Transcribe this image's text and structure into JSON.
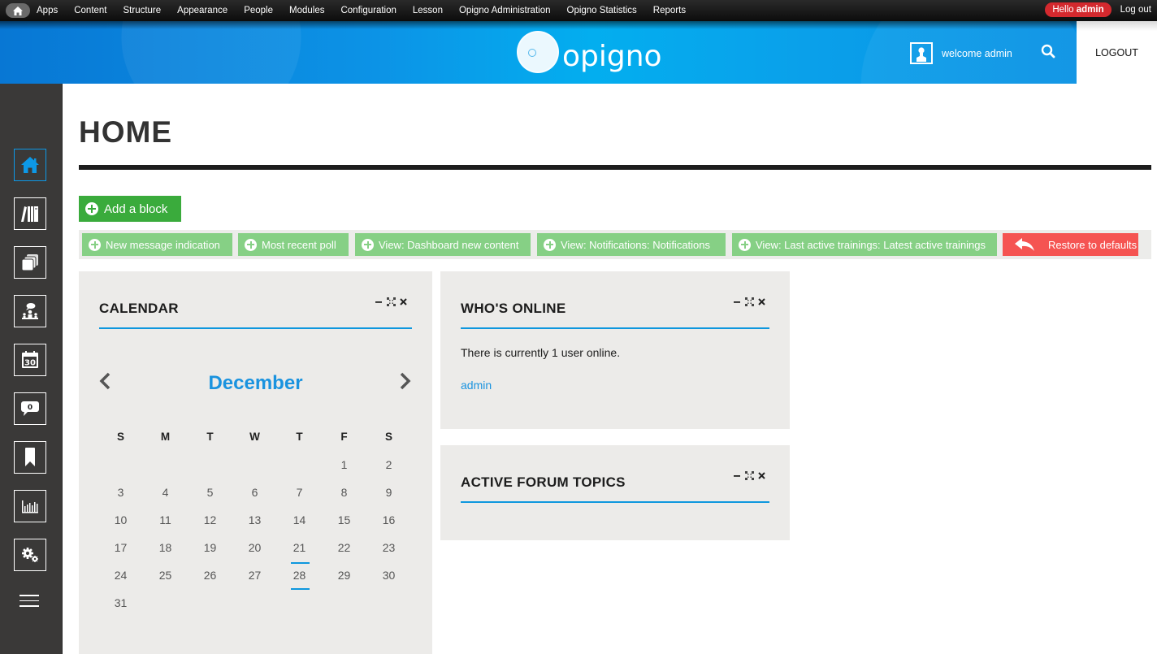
{
  "toolbar": {
    "items": [
      "Apps",
      "Content",
      "Structure",
      "Appearance",
      "People",
      "Modules",
      "Configuration",
      "Lesson",
      "Opigno Administration",
      "Opigno Statistics",
      "Reports"
    ],
    "hello_prefix": "Hello ",
    "hello_user": "admin",
    "logout": "Log out"
  },
  "header": {
    "logo_text": "opigno",
    "welcome": "welcome admin",
    "logout": "LOGOUT"
  },
  "sidebar": {
    "items": [
      {
        "name": "home",
        "active": true
      },
      {
        "name": "trainings",
        "active": false
      },
      {
        "name": "courses",
        "active": false
      },
      {
        "name": "forum",
        "active": false
      },
      {
        "name": "calendar",
        "active": false,
        "badge": "30"
      },
      {
        "name": "messages",
        "active": false,
        "badge": "0"
      },
      {
        "name": "bookmarks",
        "active": false
      },
      {
        "name": "statistics",
        "active": false
      },
      {
        "name": "settings",
        "active": false
      }
    ]
  },
  "page": {
    "title": "HOME",
    "add_block": "Add a block",
    "available_blocks": [
      "New message indication",
      "Most recent poll",
      "View: Dashboard new content",
      "View: Notifications: Notifications",
      "View: Last active trainings: Latest active trainings"
    ],
    "restore": "Restore to defaults"
  },
  "colors": {
    "accent": "#0e97de",
    "add_green": "#3aab3c",
    "chip_green": "#86d085",
    "restore_red": "#f55452",
    "hello_red": "#d3292e"
  },
  "calendar": {
    "title": "CALENDAR",
    "month": "December",
    "weekdays": [
      "S",
      "M",
      "T",
      "W",
      "T",
      "F",
      "S"
    ],
    "weeks": [
      [
        "",
        "",
        "",
        "",
        "",
        "1",
        "2"
      ],
      [
        "3",
        "4",
        "5",
        "6",
        "7",
        "8",
        "9"
      ],
      [
        "10",
        "11",
        "12",
        "13",
        "14",
        "15",
        "16"
      ],
      [
        "17",
        "18",
        "19",
        "20",
        "21",
        "22",
        "23"
      ],
      [
        "24",
        "25",
        "26",
        "27",
        "28",
        "29",
        "30"
      ],
      [
        "31",
        "",
        "",
        "",
        "",
        "",
        ""
      ]
    ],
    "today": "28"
  },
  "whos_online": {
    "title": "WHO'S ONLINE",
    "text": "There is currently 1 user online.",
    "users": [
      "admin"
    ]
  },
  "forum": {
    "title": "ACTIVE FORUM TOPICS"
  }
}
